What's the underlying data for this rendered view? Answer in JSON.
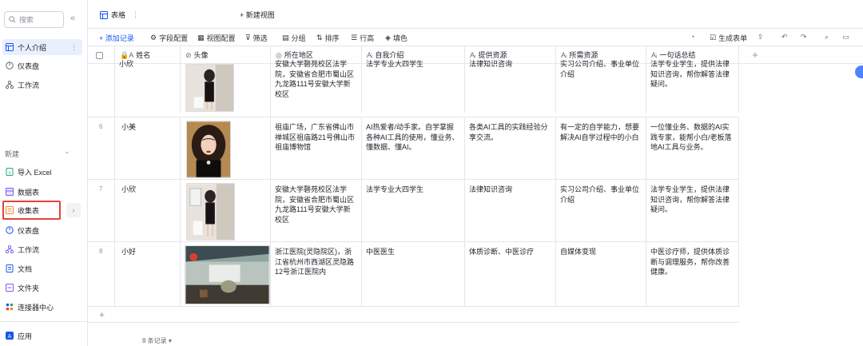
{
  "sidebar": {
    "search_placeholder": "搜索",
    "top_items": [
      {
        "label": "个人介绍",
        "icon": "table-icon"
      },
      {
        "label": "仪表盘",
        "icon": "dashboard-icon"
      },
      {
        "label": "工作流",
        "icon": "workflow-icon"
      }
    ],
    "new_section": "新建",
    "new_items": [
      {
        "label": "导入 Excel",
        "icon": "excel-icon"
      },
      {
        "label": "数据表",
        "icon": "datasheet-icon"
      },
      {
        "label": "收集表",
        "icon": "form-icon"
      },
      {
        "label": "仪表盘",
        "icon": "dashboard-icon"
      },
      {
        "label": "工作流",
        "icon": "workflow-icon"
      },
      {
        "label": "文档",
        "icon": "doc-icon"
      },
      {
        "label": "文件夹",
        "icon": "folder-icon"
      },
      {
        "label": "连接器中心",
        "icon": "connector-icon"
      }
    ],
    "app": "应用",
    "colors": {
      "active_bg": "#e8efff",
      "highlight": "#e5413a"
    }
  },
  "tabs": {
    "active": "表格",
    "new_view": "+ 新建视图"
  },
  "toolbar": {
    "add": "+ 添加记录",
    "fields": "字段配置",
    "view": "视图配置",
    "filter": "筛选",
    "group": "分组",
    "sort": "排序",
    "row_height": "行高",
    "fill": "填色",
    "generate_form": "生成表单"
  },
  "columns": [
    "姓名",
    "头像",
    "所在地区",
    "自我介绍",
    "提供资源",
    "所需资源",
    "一句话总结"
  ],
  "rows": [
    {
      "index": "",
      "name": "小欣",
      "area": "安徽大学磬苑校区法学院，安徽省合肥市蜀山区九龙路111号安徽大学新校区",
      "intro": "法学专业大四学生",
      "provide": "法律知识咨询",
      "need": "实习公司介绍、事业单位介绍",
      "summary": "法学专业学生，提供法律知识咨询，帮你解答法律疑问。"
    },
    {
      "index": "6",
      "name": "小美",
      "area": "祖庙广场，广东省佛山市禅城区祖庙路21号佛山市祖庙博物馆",
      "intro": "AI热爱者/动手家。自学掌握各种AI工具的使用，懂业务、懂数据、懂AI。",
      "provide": "各类AI工具的实践经验分享交流。",
      "need": "有一定的自学能力，想要解决AI自学过程中的小白",
      "summary": "一位懂业务、数据的AI实践专家，能帮小白/老板落地AI工具与业务。"
    },
    {
      "index": "7",
      "name": "小欣",
      "area": "安徽大学磬苑校区法学院，安徽省合肥市蜀山区九龙路111号安徽大学新校区",
      "intro": "法学专业大四学生",
      "provide": "法律知识咨询",
      "need": "实习公司介绍、事业单位介绍",
      "summary": "法学专业学生，提供法律知识咨询，帮你解答法律疑问。"
    },
    {
      "index": "8",
      "name": "小好",
      "area": "浙江医院(灵隐院区)，浙江省杭州市西湖区灵隐路12号浙江医院内",
      "intro": "中医医生",
      "provide": "体质诊断、中医诊疗",
      "need": "自媒体变现",
      "summary": "中医诊疗师，提供体质诊断与调理服务，帮你改善健康。"
    }
  ],
  "first_row_partial": {
    "area": "安徽大学磬苑校区法学院，安徽省合肥市蜀山区九龙路111号安徽大学新校区",
    "intro": "法学专业大四学生",
    "provide": "法律知识咨询",
    "need": "实习公司介绍、事业单位介绍",
    "summary": "法学专业学生，提供法律知识咨询，帮你解答法律疑问。"
  },
  "footer": "8 条记录 ▾"
}
